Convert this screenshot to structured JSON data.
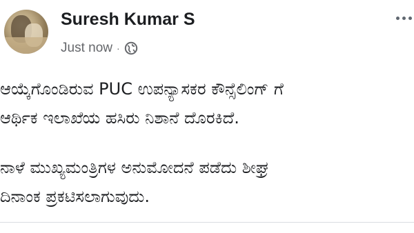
{
  "post": {
    "author": "Suresh Kumar S",
    "timestamp": "Just now",
    "separator": "·",
    "privacy_icon": "globe-icon",
    "more_icon": "more-options-icon",
    "lines": [
      "ಆಯ್ಕೆಗೊಂಡಿರುವ PUC ಉಪನ್ಯಾಸಕರ ಕೌನ್ಸೆಲಿಂಗ್ ಗೆ",
      "ಆರ್ಥಿಕ ಇಲಾಖೆಯ ಹಸಿರು ನಿಶಾನೆ ದೊರಕಿದೆ.",
      "ನಾಳೆ ಮುಖ್ಯಮಂತ್ರಿಗಳ ಅನುಮೋದನೆ ಪಡೆದು ಶೀಘ್ರ",
      "ದಿನಾಂಕ ಪ್ರಕಟಿಸಲಾಗುವುದು."
    ]
  },
  "colors": {
    "text": "#1c1e21",
    "meta": "#65676b",
    "divider": "#dadde1"
  }
}
